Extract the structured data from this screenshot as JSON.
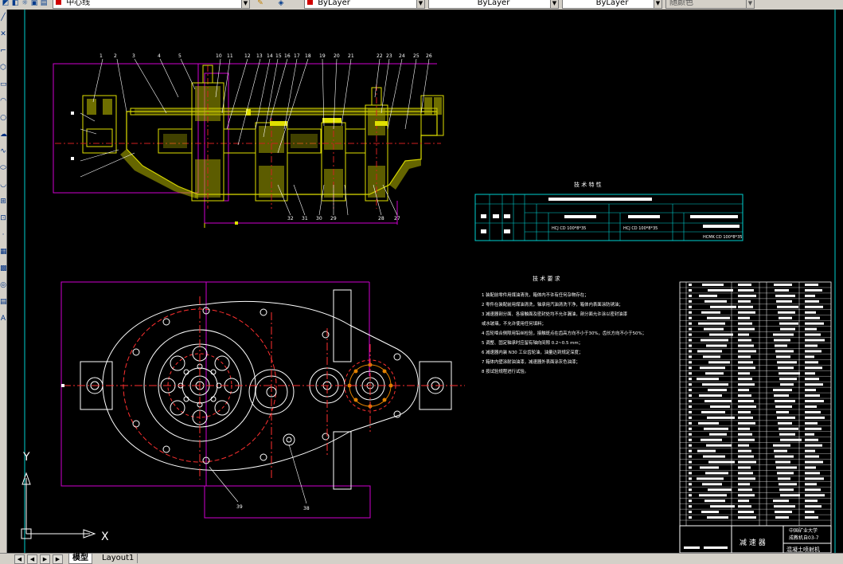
{
  "toolbar": {
    "linetype_value": "中心线",
    "layer_color_value": "ByLayer",
    "linetype_combo_value": "ByLayer",
    "lineweight_value": "ByLayer",
    "plotstyle_value": "随颜色",
    "accent_red": "#d00000"
  },
  "drawing": {
    "spec_title": "技 术 特 性",
    "requirements_title": "技 术 要 求",
    "requirements": [
      "1 装配前零件用煤油清洗，箱体内不许有任何杂物存在；",
      "2 零件在装配前用煤油清洗，轴承用汽油清洗干净，箱体内表面涂防锈油；",
      "3 减速器剖分面、各接触面及密封处均不允许漏油，剖分面允许涂以密封油漆",
      "   或水玻璃，不允许使用任何填料；",
      "4 齿轮啮合侧隙用铅丝检验，接触斑点在齿高方向不小于30%，齿长方向不小于50%；",
      "5 调整、固定轴承时应留有轴向间隙 0.2~0.5 mm；",
      "6 减速器内装 N30 工业齿轮油，油量达到规定深度；",
      "7 箱体内壁涂耐油油漆，减速器外表面涂灰色油漆；",
      "8 按试验规程进行试验。"
    ],
    "spec_cells": [
      "HCJ CD 100*8*35",
      "HCJ CD 100*8*35",
      "HCMK CD 100*8*35"
    ],
    "title_block_name": "减 速 器",
    "school": "中国矿业大学",
    "school_sub": "成教机自03-7",
    "product": "混凝土喷射机",
    "balloons_top": [
      "1",
      "2",
      "3",
      "4",
      "5",
      "6",
      "7",
      "8",
      "9",
      "10",
      "11",
      "12",
      "13",
      "14",
      "15",
      "16",
      "17",
      "18",
      "19",
      "20",
      "21",
      "22",
      "23",
      "24",
      "25",
      "26"
    ],
    "balloons_bottom": [
      "32",
      "31",
      "30",
      "29",
      "28",
      "27"
    ],
    "leader_left": "39",
    "leader_mid": "38"
  },
  "ucs": {
    "x_label": "X",
    "y_label": "Y"
  },
  "tabs": {
    "model": "模型",
    "layout1": "Layout1"
  }
}
